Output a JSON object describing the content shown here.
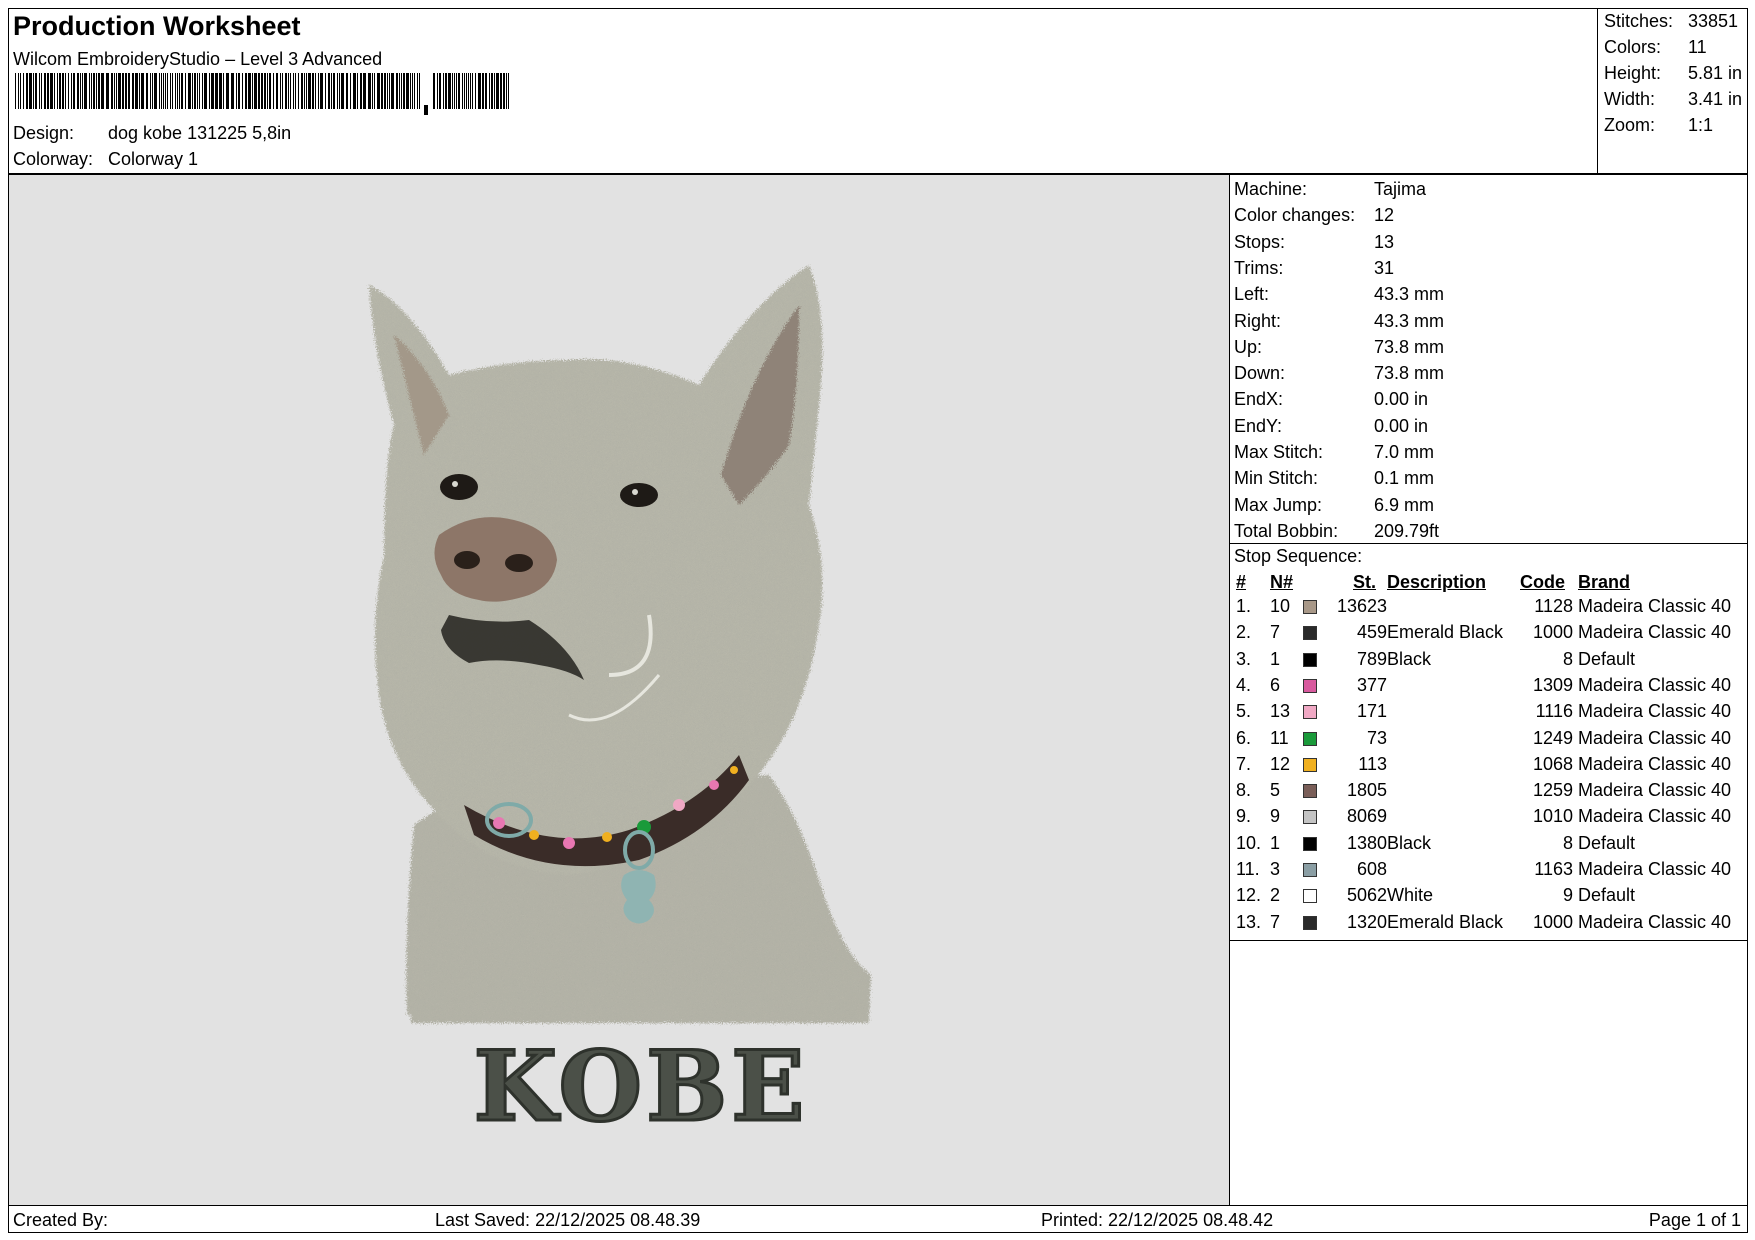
{
  "header": {
    "title": "Production Worksheet",
    "subtitle": "Wilcom EmbroideryStudio – Level 3 Advanced",
    "design_label": "Design:",
    "design_value": "dog kobe  131225 5,8in",
    "colorway_label": "Colorway:",
    "colorway_value": "Colorway 1"
  },
  "summary": [
    {
      "label": "Stitches:",
      "value": "33851"
    },
    {
      "label": "Colors:",
      "value": "11"
    },
    {
      "label": "Height:",
      "value": "5.81 in"
    },
    {
      "label": "Width:",
      "value": "3.41 in"
    },
    {
      "label": "Zoom:",
      "value": "1:1"
    }
  ],
  "machine_info": [
    {
      "label": "Machine:",
      "value": "Tajima"
    },
    {
      "label": "Color changes:",
      "value": "12"
    },
    {
      "label": "Stops:",
      "value": "13"
    },
    {
      "label": "Trims:",
      "value": "31"
    },
    {
      "label": "Left:",
      "value": "43.3 mm"
    },
    {
      "label": "Right:",
      "value": "43.3 mm"
    },
    {
      "label": "Up:",
      "value": "73.8 mm"
    },
    {
      "label": "Down:",
      "value": "73.8 mm"
    },
    {
      "label": "EndX:",
      "value": "0.00 in"
    },
    {
      "label": "EndY:",
      "value": "0.00 in"
    },
    {
      "label": "Max Stitch:",
      "value": "7.0 mm"
    },
    {
      "label": "Min Stitch:",
      "value": "0.1 mm"
    },
    {
      "label": "Max Jump:",
      "value": "6.9 mm"
    },
    {
      "label": "Total Bobbin:",
      "value": "209.79ft"
    }
  ],
  "stop_sequence": {
    "title": "Stop Sequence:",
    "headers": {
      "idx": "#",
      "n": "N#",
      "st": "St.",
      "desc": "Description",
      "code": "Code",
      "brand": "Brand"
    },
    "rows": [
      {
        "idx": "1.",
        "n": "10",
        "color": "#a89888",
        "st": "13623",
        "desc": "",
        "code": "1128",
        "brand": "Madeira Classic 40"
      },
      {
        "idx": "2.",
        "n": "7",
        "color": "#2a2a2a",
        "st": "459",
        "desc": "Emerald Black",
        "code": "1000",
        "brand": "Madeira Classic 40"
      },
      {
        "idx": "3.",
        "n": "1",
        "color": "#000000",
        "st": "789",
        "desc": "Black",
        "code": "8",
        "brand": "Default"
      },
      {
        "idx": "4.",
        "n": "6",
        "color": "#d85a9e",
        "st": "377",
        "desc": "",
        "code": "1309",
        "brand": "Madeira Classic 40"
      },
      {
        "idx": "5.",
        "n": "13",
        "color": "#f0a8c4",
        "st": "171",
        "desc": "",
        "code": "1116",
        "brand": "Madeira Classic 40"
      },
      {
        "idx": "6.",
        "n": "11",
        "color": "#1a9a3a",
        "st": "73",
        "desc": "",
        "code": "1249",
        "brand": "Madeira Classic 40"
      },
      {
        "idx": "7.",
        "n": "12",
        "color": "#f0b020",
        "st": "113",
        "desc": "",
        "code": "1068",
        "brand": "Madeira Classic 40"
      },
      {
        "idx": "8.",
        "n": "5",
        "color": "#7a5e58",
        "st": "1805",
        "desc": "",
        "code": "1259",
        "brand": "Madeira Classic 40"
      },
      {
        "idx": "9.",
        "n": "9",
        "color": "#c4c4c4",
        "st": "8069",
        "desc": "",
        "code": "1010",
        "brand": "Madeira Classic 40"
      },
      {
        "idx": "10.",
        "n": "1",
        "color": "#000000",
        "st": "1380",
        "desc": "Black",
        "code": "8",
        "brand": "Default"
      },
      {
        "idx": "11.",
        "n": "3",
        "color": "#8a9ea4",
        "st": "608",
        "desc": "",
        "code": "1163",
        "brand": "Madeira Classic 40"
      },
      {
        "idx": "12.",
        "n": "2",
        "color": "#ffffff",
        "st": "5062",
        "desc": "White",
        "code": "9",
        "brand": "Default"
      },
      {
        "idx": "13.",
        "n": "7",
        "color": "#2a2a2a",
        "st": "1320",
        "desc": "Emerald Black",
        "code": "1000",
        "brand": "Madeira Classic 40"
      }
    ]
  },
  "design_image": {
    "text": "KOBE"
  },
  "footer": {
    "created_by": "Created By:",
    "last_saved": "Last Saved: 22/12/2025 08.48.39",
    "printed": "Printed: 22/12/2025 08.48.42",
    "page": "Page 1 of 1"
  }
}
